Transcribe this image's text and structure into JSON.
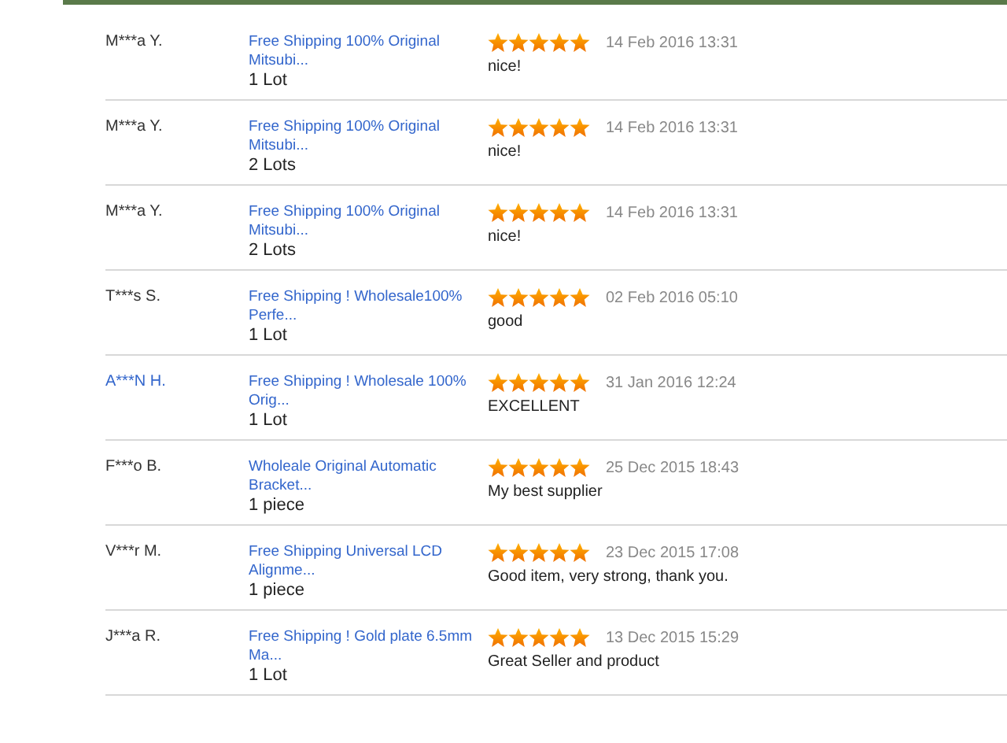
{
  "feedback": [
    {
      "buyer": "M***a Y.",
      "buyer_linked": false,
      "product": "Free Shipping 100% Original Mitsubi...",
      "quantity": "1 Lot",
      "stars": 5,
      "date": "14 Feb 2016 13:31",
      "comment": "nice!"
    },
    {
      "buyer": "M***a Y.",
      "buyer_linked": false,
      "product": "Free Shipping 100% Original Mitsubi...",
      "quantity": "2 Lots",
      "stars": 5,
      "date": "14 Feb 2016 13:31",
      "comment": "nice!"
    },
    {
      "buyer": "M***a Y.",
      "buyer_linked": false,
      "product": "Free Shipping 100% Original Mitsubi...",
      "quantity": "2 Lots",
      "stars": 5,
      "date": "14 Feb 2016 13:31",
      "comment": "nice!"
    },
    {
      "buyer": "T***s S.",
      "buyer_linked": false,
      "product": "Free Shipping ! Wholesale100% Perfe...",
      "quantity": "1 Lot",
      "stars": 5,
      "date": "02 Feb 2016 05:10",
      "comment": "good"
    },
    {
      "buyer": "A***N H.",
      "buyer_linked": true,
      "product": "Free Shipping ! Wholesale 100% Orig...",
      "quantity": "1 Lot",
      "stars": 5,
      "date": "31 Jan 2016 12:24",
      "comment": "EXCELLENT"
    },
    {
      "buyer": "F***o B.",
      "buyer_linked": false,
      "product": "Wholeale Original Automatic Bracket...",
      "quantity": "1 piece",
      "stars": 5,
      "date": "25 Dec 2015 18:43",
      "comment": "My best supplier"
    },
    {
      "buyer": "V***r M.",
      "buyer_linked": false,
      "product": "Free Shipping Universal LCD Alignme...",
      "quantity": "1 piece",
      "stars": 5,
      "date": "23 Dec 2015 17:08",
      "comment": "Good item, very strong, thank you."
    },
    {
      "buyer": "J***a R.",
      "buyer_linked": false,
      "product": "Free Shipping ! Gold plate 6.5mm Ma...",
      "quantity": "1 Lot",
      "stars": 5,
      "date": "13 Dec 2015 15:29",
      "comment": "Great Seller and product"
    }
  ]
}
